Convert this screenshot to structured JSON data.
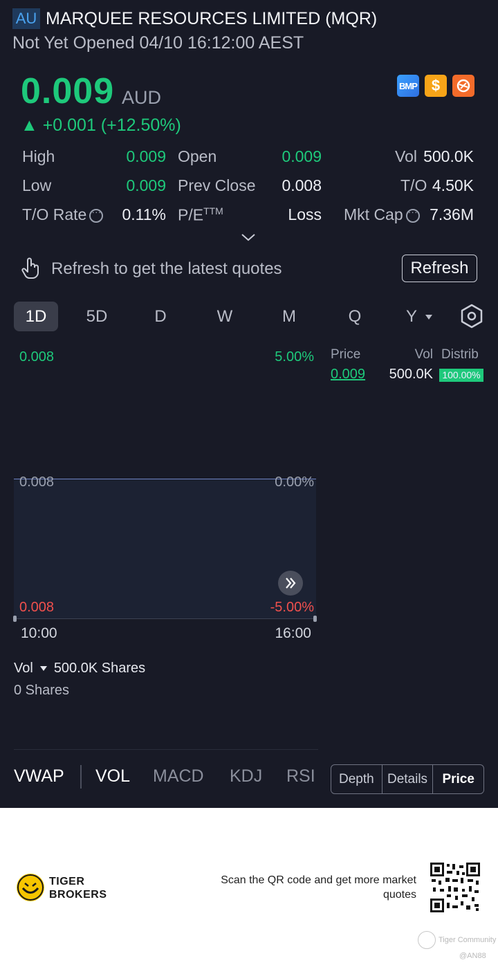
{
  "header": {
    "market": "AU",
    "stock_name": "MARQUEE RESOURCES LIMITED (MQR)",
    "status": "Not Yet Opened 04/10 16:12:00 AEST"
  },
  "quote": {
    "price": "0.009",
    "currency": "AUD",
    "change": "▲ +0.001 (+12.50%)",
    "badges": [
      "BMP",
      "$",
      "tiger-icon"
    ]
  },
  "stats": {
    "high_label": "High",
    "high": "0.009",
    "open_label": "Open",
    "open": "0.009",
    "vol_label": "Vol",
    "vol": "500.0K",
    "low_label": "Low",
    "low": "0.009",
    "prev_close_label": "Prev Close",
    "prev_close": "0.008",
    "to_label": "T/O",
    "to": "4.50K",
    "to_rate_label": "T/O Rate",
    "to_rate": "0.11%",
    "pe_label": "P/E",
    "pe_sup": "TTM",
    "pe": "Loss",
    "mkt_cap_label": "Mkt Cap",
    "mkt_cap": "7.36M"
  },
  "refresh": {
    "message": "Refresh to get the latest quotes",
    "button": "Refresh"
  },
  "tabs": [
    "1D",
    "5D",
    "D",
    "W",
    "M",
    "Q",
    "Y"
  ],
  "active_tab": "1D",
  "chart": {
    "top_left": "0.008",
    "top_right": "5.00%",
    "mid_left": "0.008",
    "mid_right": "0.00%",
    "bot_left": "0.008",
    "bot_right": "-5.00%",
    "time_start": "10:00",
    "time_end": "16:00"
  },
  "distribution": {
    "headers": [
      "Price",
      "Vol",
      "Distrib"
    ],
    "rows": [
      {
        "price": "0.009",
        "vol": "500.0K",
        "pct": "100.00%"
      }
    ]
  },
  "volume": {
    "label": "Vol",
    "shares": "500.0K Shares",
    "sub": "0 Shares"
  },
  "indicators": [
    "VWAP",
    "VOL",
    "MACD",
    "KDJ",
    "RSI"
  ],
  "segments": [
    "Depth",
    "Details",
    "Price"
  ],
  "footer": {
    "brand_line1": "TIGER",
    "brand_line2": "BROKERS",
    "qr_text": "Scan the QR code and get more market quotes",
    "watermark": "Tiger Community",
    "watermark_user": "@AN88"
  },
  "colors": {
    "up": "#1ec97b",
    "down": "#f0504d",
    "background": "#181a26"
  }
}
